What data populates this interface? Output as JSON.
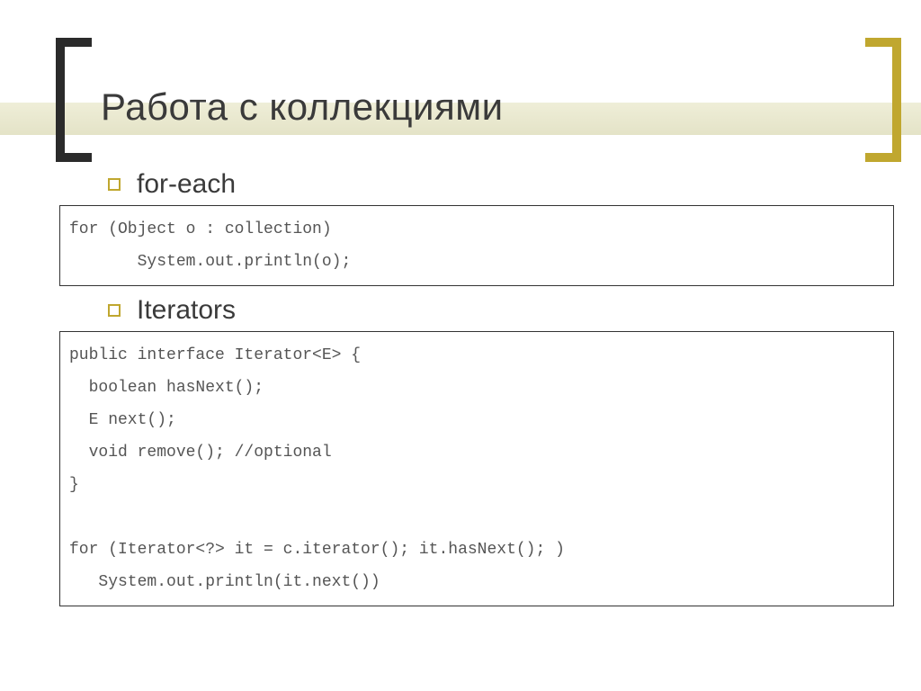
{
  "title": "Работа с коллекциями",
  "bullets": {
    "b1": "for-each",
    "b2": "Iterators"
  },
  "code": {
    "block1": "for (Object o : collection)\n       System.out.println(o);",
    "block2": "public interface Iterator<E> {\n  boolean hasNext();\n  E next();\n  void remove(); //optional\n}\n\nfor (Iterator<?> it = c.iterator(); it.hasNext(); )\n   System.out.println(it.next())"
  },
  "colors": {
    "accent": "#c0a72f",
    "dark": "#2b2b2b",
    "stripe": "#e6e5cc"
  }
}
